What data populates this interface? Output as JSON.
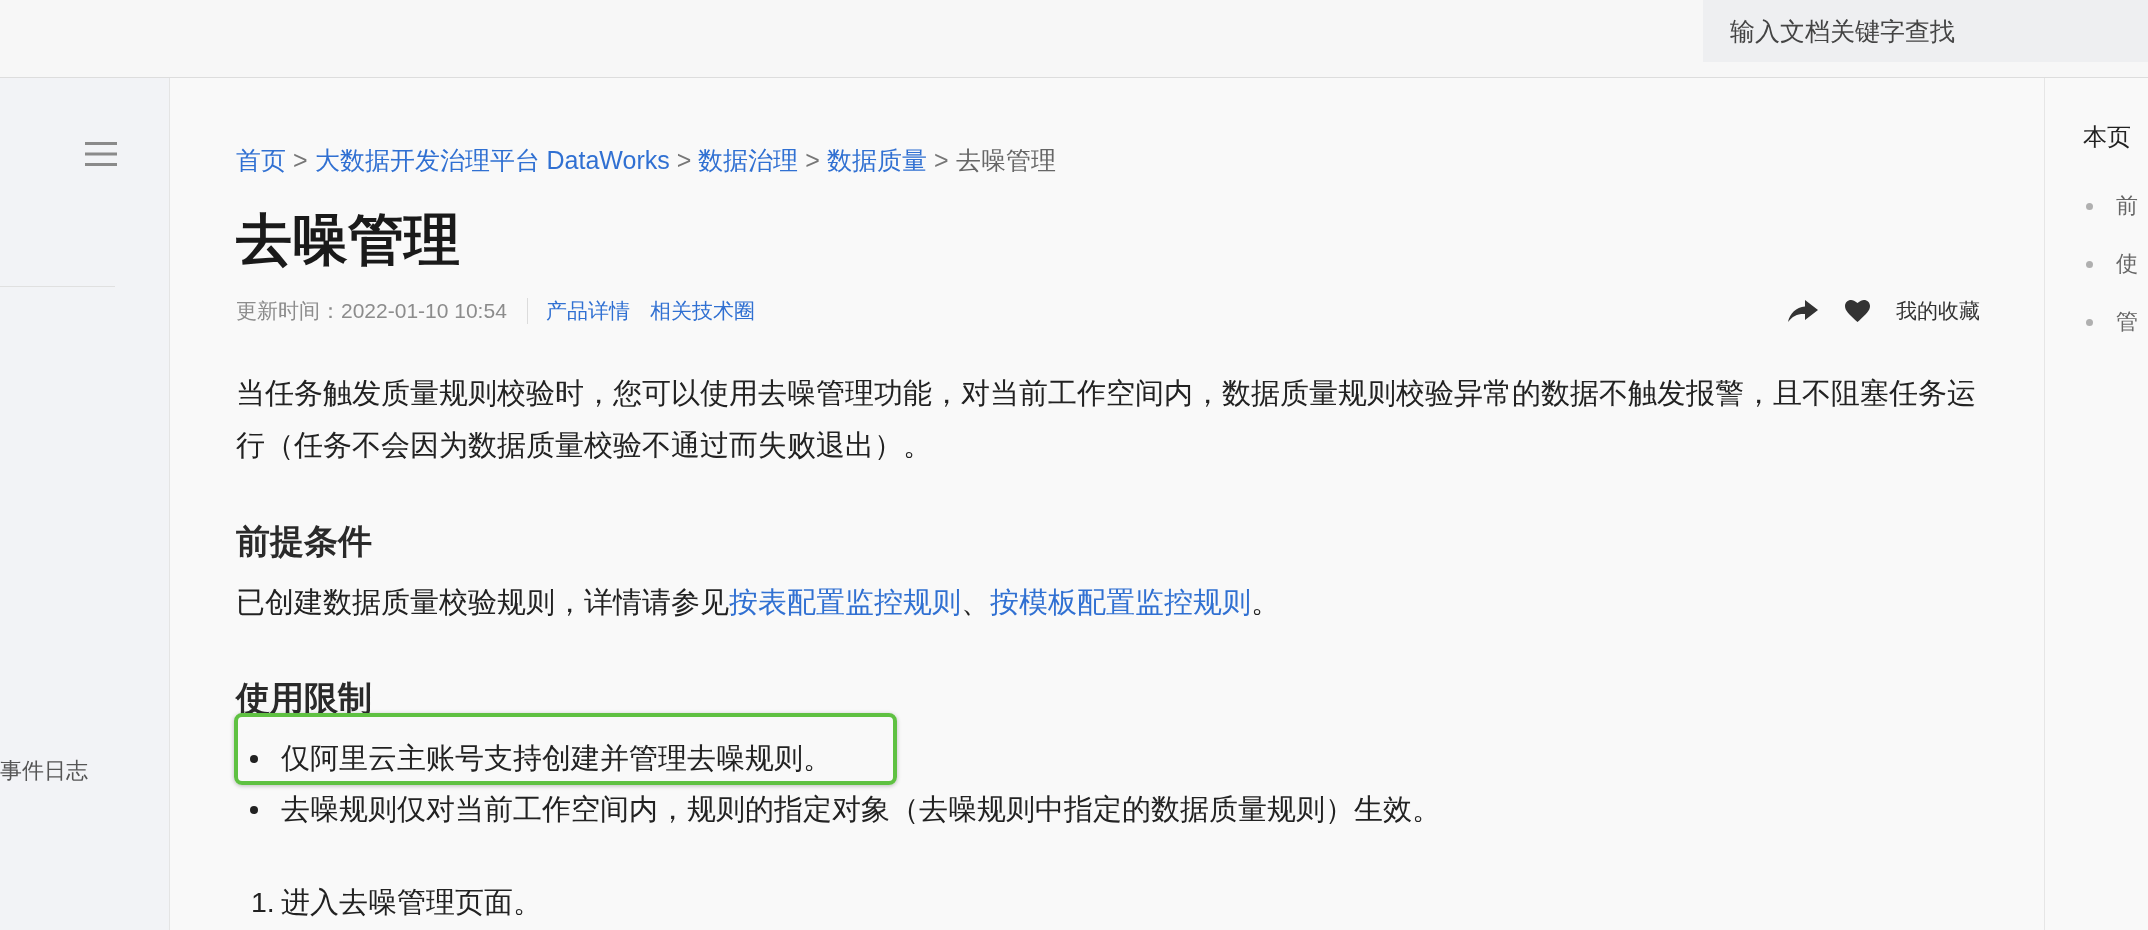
{
  "search": {
    "placeholder": "输入文档关键字查找"
  },
  "sidebar": {
    "items": [
      {
        "label": "事件日志"
      }
    ]
  },
  "breadcrumb": [
    {
      "kind": "link",
      "label": "首页"
    },
    {
      "kind": "separator",
      "label": ">"
    },
    {
      "kind": "link",
      "label": "大数据开发治理平台 DataWorks"
    },
    {
      "kind": "separator",
      "label": ">"
    },
    {
      "kind": "link",
      "label": "数据治理"
    },
    {
      "kind": "separator",
      "label": ">"
    },
    {
      "kind": "link",
      "label": "数据质量"
    },
    {
      "kind": "separator",
      "label": ">"
    },
    {
      "kind": "current",
      "label": "去噪管理"
    }
  ],
  "title": "去噪管理",
  "meta": {
    "updated": "更新时间：2022-01-10 10:54",
    "links": [
      "产品详情",
      "相关技术圈"
    ],
    "favorite": "我的收藏"
  },
  "intro": "当任务触发质量规则校验时，您可以使用去噪管理功能，对当前工作空间内，数据质量规则校验异常的数据不触发报警，且不阻塞任务运行（任务不会因为数据质量校验不通过而失败退出）。",
  "sections": [
    {
      "heading": "前提条件",
      "blocks": [
        {
          "kind": "paragraph",
          "runs": [
            {
              "kind": "text",
              "text": "已创建数据质量校验规则，详情请参见"
            },
            {
              "kind": "link",
              "text": "按表配置监控规则"
            },
            {
              "kind": "text",
              "text": "、"
            },
            {
              "kind": "link",
              "text": "按模板配置监控规则"
            },
            {
              "kind": "text",
              "text": "。"
            }
          ]
        }
      ]
    },
    {
      "heading": "使用限制",
      "blocks": [
        {
          "kind": "bullets",
          "items": [
            {
              "text": "仅阿里云主账号支持创建并管理去噪规则。",
              "highlighted": true
            },
            {
              "text": "去噪规则仅对当前工作空间内，规则的指定对象（去噪规则中指定的数据质量规则）生效。",
              "highlighted": false
            }
          ]
        },
        {
          "kind": "steps",
          "items": [
            {
              "number": "1.",
              "text": "进入去噪管理页面。"
            }
          ]
        }
      ]
    }
  ],
  "toc": {
    "title": "本页",
    "items": [
      {
        "label": "前"
      },
      {
        "label": "使"
      },
      {
        "label": "管"
      }
    ]
  }
}
